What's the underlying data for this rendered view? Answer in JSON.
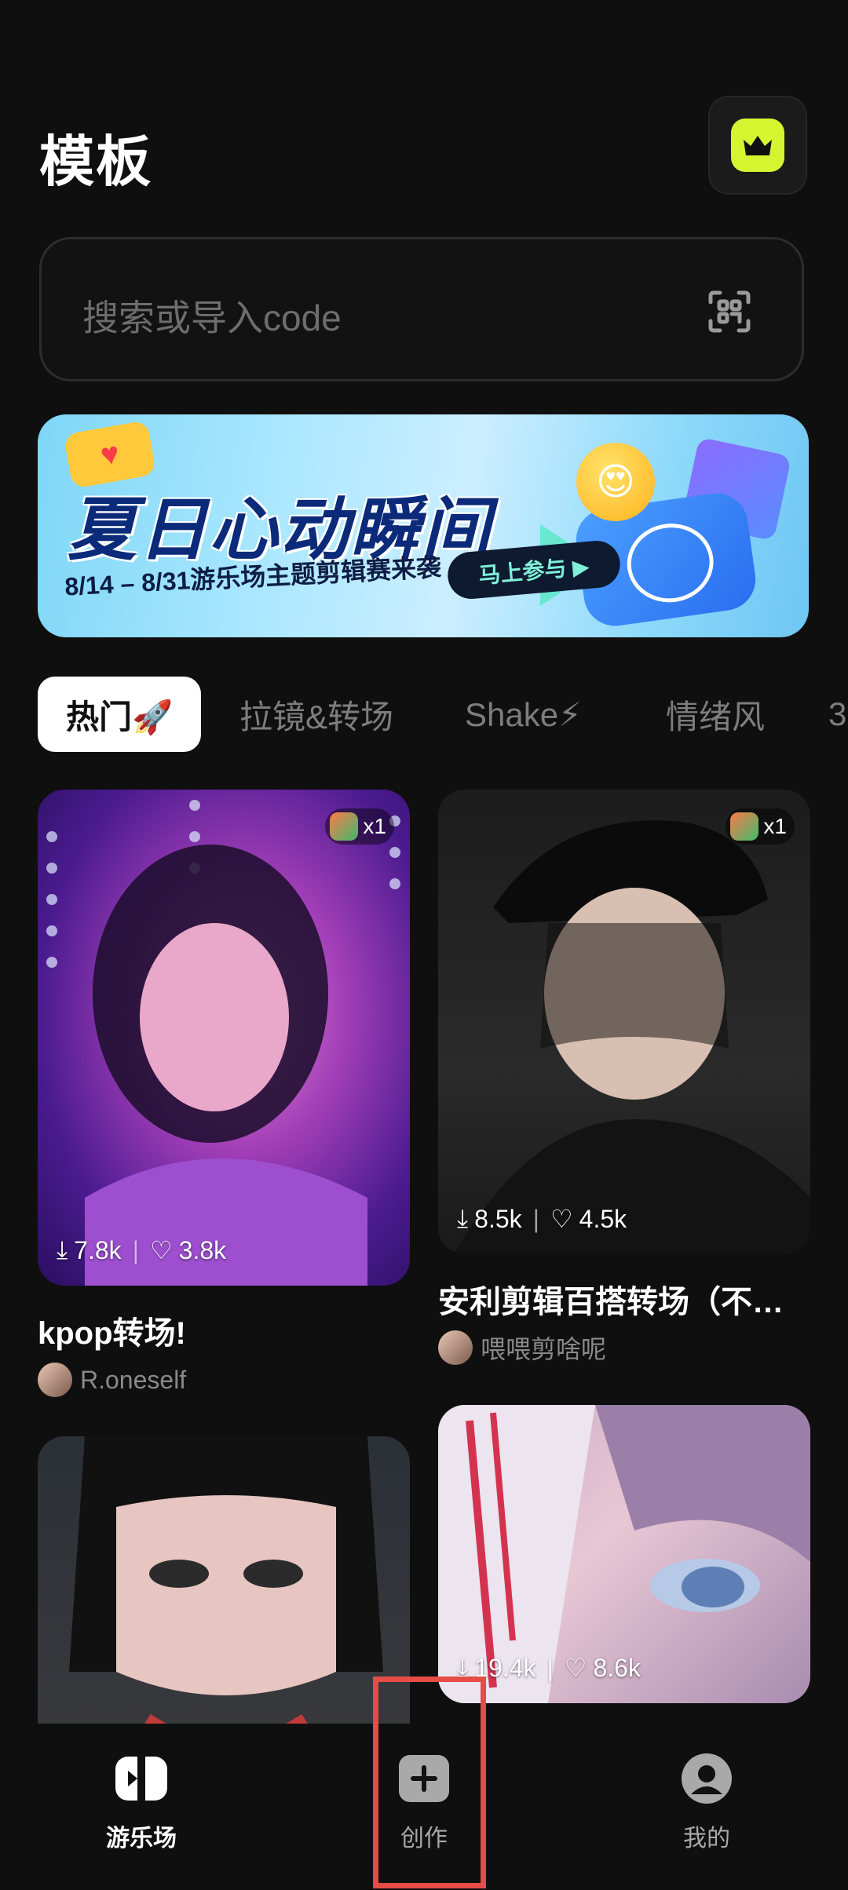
{
  "header": {
    "title": "模板"
  },
  "search": {
    "placeholder": "搜索或导入code"
  },
  "banner": {
    "title": "夏日心动瞬间",
    "subtitle": "8/14 – 8/31游乐场主题剪辑赛来袭",
    "cta": "马上参与 ▶"
  },
  "tabs": [
    {
      "label": "热门🚀",
      "active": true
    },
    {
      "label": "拉镜&转场"
    },
    {
      "label": "Shake⚡"
    },
    {
      "label": "情绪风"
    },
    {
      "label": "3"
    }
  ],
  "templates": [
    {
      "title": "kpop转场!",
      "author": "R.oneself",
      "downloads": "7.8k",
      "likes": "3.8k",
      "badge": "x1"
    },
    {
      "title": "安利剪辑百搭转场（不…",
      "author": "喂喂剪啥呢",
      "downloads": "8.5k",
      "likes": "4.5k",
      "badge": "x1"
    },
    {
      "title": "",
      "author": "",
      "downloads": "",
      "likes": ""
    },
    {
      "title": "",
      "author": "",
      "downloads": "19.4k",
      "likes": "8.6k"
    }
  ],
  "nav": {
    "items": [
      {
        "label": "游乐场",
        "icon": "playground-icon",
        "active": true
      },
      {
        "label": "创作",
        "icon": "create-plus-icon"
      },
      {
        "label": "我的",
        "icon": "profile-icon"
      }
    ]
  },
  "colors": {
    "accent": "#d5f531",
    "highlight": "#e44c45"
  }
}
